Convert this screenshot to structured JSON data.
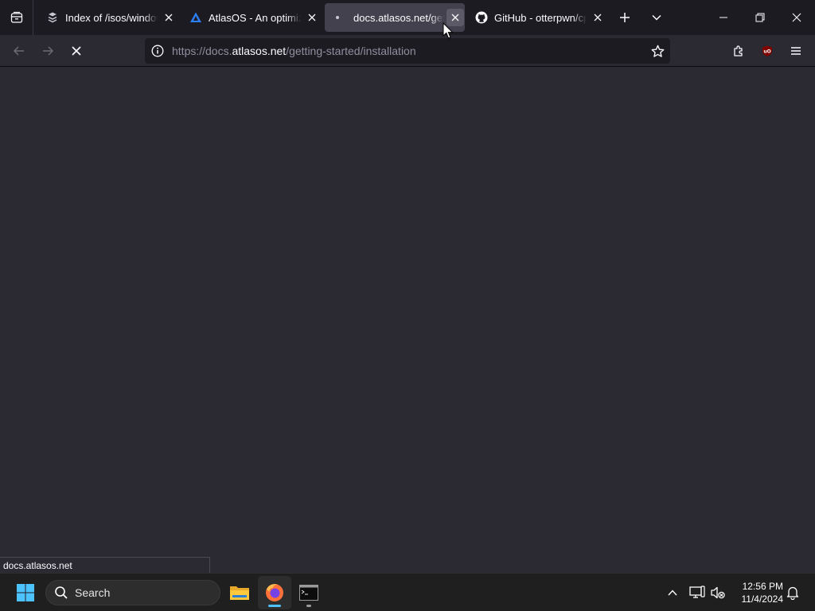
{
  "tabs": [
    {
      "title": "Index of /isos/windows",
      "active": false,
      "icon": "pages-favicon-icon"
    },
    {
      "title": "AtlasOS - An optimized",
      "active": false,
      "icon": "atlasos-favicon-icon"
    },
    {
      "title": "docs.atlasos.net/getting",
      "active": true,
      "icon": "loading-dot-icon"
    },
    {
      "title": "GitHub - otterpwn/cpp",
      "active": false,
      "icon": "github-favicon-icon"
    }
  ],
  "urlbar": {
    "scheme": "https://docs.",
    "host": "atlasos.net",
    "path": "/getting-started/installation"
  },
  "status_text": "docs.atlasos.net",
  "taskbar": {
    "search_label": "Search",
    "time": "12:56 PM",
    "date": "11/4/2024"
  },
  "colors": {
    "tab_strip": "#1c1b22",
    "toolbar": "#2b2a33",
    "active_tab": "#42414d",
    "taskbar": "#1f1f1f",
    "accent": "#4cc2ff"
  }
}
